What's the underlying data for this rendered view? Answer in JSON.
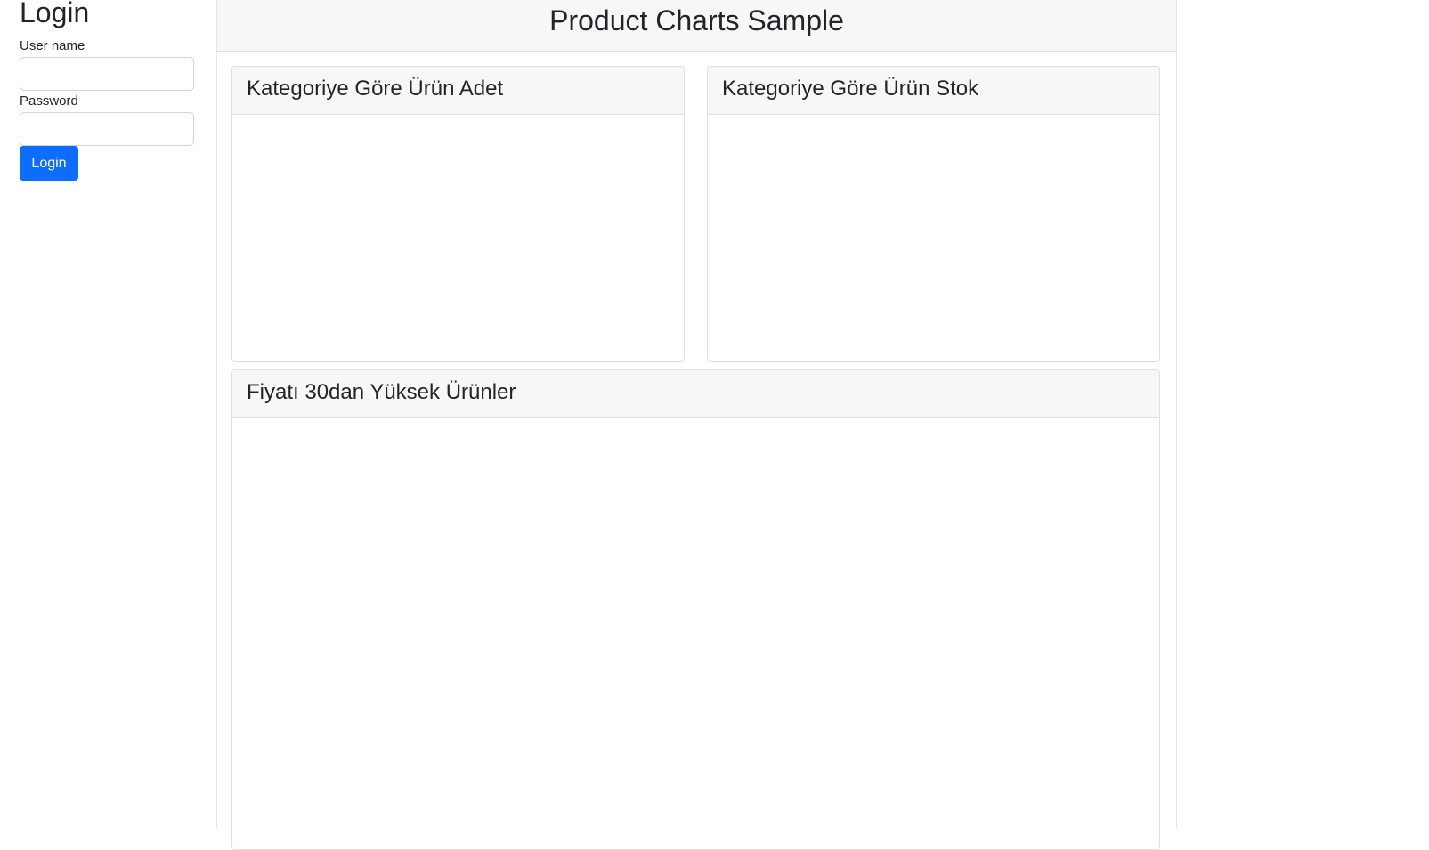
{
  "login": {
    "title": "Login",
    "username_label": "User name",
    "username_value": "",
    "password_label": "Password",
    "password_value": "",
    "button_label": "Login"
  },
  "main": {
    "title": "Product Charts Sample",
    "cards": [
      {
        "title": "Kategoriye Göre Ürün Adet"
      },
      {
        "title": "Kategoriye Göre Ürün Stok"
      },
      {
        "title": "Fiyatı 30dan Yüksek Ürünler"
      }
    ]
  },
  "colors": {
    "primary": "#0d6efd",
    "header_bg": "#f7f7f7",
    "border": "#dfdfdf",
    "text": "#212529"
  }
}
